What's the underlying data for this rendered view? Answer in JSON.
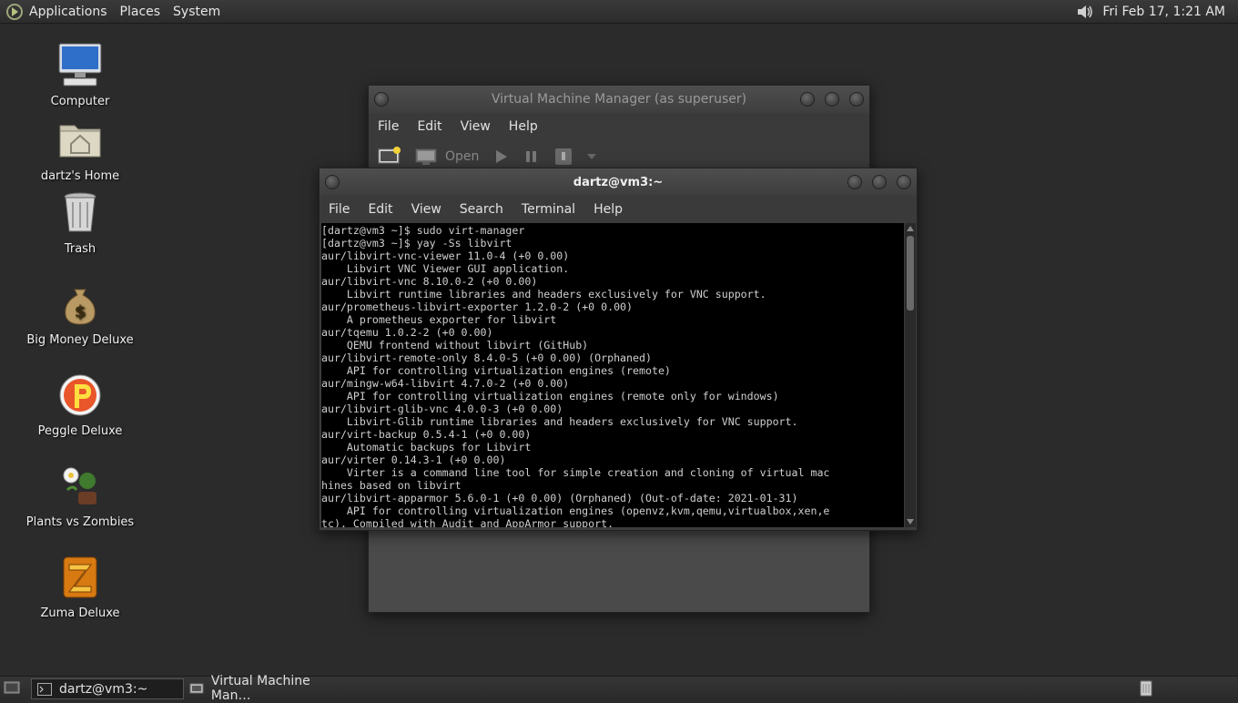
{
  "top_panel": {
    "menus": [
      "Applications",
      "Places",
      "System"
    ],
    "clock": "Fri Feb 17,  1:21 AM"
  },
  "desktop_icons": [
    {
      "label": "Computer",
      "icon": "computer-icon"
    },
    {
      "label": "dartz's Home",
      "icon": "home-folder-icon"
    },
    {
      "label": "Trash",
      "icon": "trash-icon"
    },
    {
      "label": "Big Money Deluxe",
      "icon": "money-bag-icon"
    },
    {
      "label": "Peggle Deluxe",
      "icon": "peggle-icon"
    },
    {
      "label": "Plants vs Zombies",
      "icon": "plants-vs-zombies-icon"
    },
    {
      "label": "Zuma Deluxe",
      "icon": "zuma-icon"
    }
  ],
  "vmm_window": {
    "title": "Virtual Machine Manager (as superuser)",
    "menus": [
      "File",
      "Edit",
      "View",
      "Help"
    ],
    "toolbar": {
      "open_label": "Open"
    }
  },
  "terminal_window": {
    "title": "dartz@vm3:~",
    "menus": [
      "File",
      "Edit",
      "View",
      "Search",
      "Terminal",
      "Help"
    ],
    "output": "[dartz@vm3 ~]$ sudo virt-manager\n[dartz@vm3 ~]$ yay -Ss libvirt\naur/libvirt-vnc-viewer 11.0-4 (+0 0.00)\n    Libvirt VNC Viewer GUI application.\naur/libvirt-vnc 8.10.0-2 (+0 0.00)\n    Libvirt runtime libraries and headers exclusively for VNC support.\naur/prometheus-libvirt-exporter 1.2.0-2 (+0 0.00)\n    A prometheus exporter for libvirt\naur/tqemu 1.0.2-2 (+0 0.00)\n    QEMU frontend without libvirt (GitHub)\naur/libvirt-remote-only 8.4.0-5 (+0 0.00) (Orphaned)\n    API for controlling virtualization engines (remote)\naur/mingw-w64-libvirt 4.7.0-2 (+0 0.00)\n    API for controlling virtualization engines (remote only for windows)\naur/libvirt-glib-vnc 4.0.0-3 (+0 0.00)\n    Libvirt-Glib runtime libraries and headers exclusively for VNC support.\naur/virt-backup 0.5.4-1 (+0 0.00)\n    Automatic backups for Libvirt\naur/virter 0.14.3-1 (+0 0.00)\n    Virter is a command line tool for simple creation and cloning of virtual mac\nhines based on libvirt\naur/libvirt-apparmor 5.6.0-1 (+0 0.00) (Orphaned) (Out-of-date: 2021-01-31)\n    API for controlling virtualization engines (openvz,kvm,qemu,virtualbox,xen,e\ntc). Compiled with Audit and AppArmor support."
  },
  "taskbar": {
    "tasks": [
      {
        "label": "dartz@vm3:~",
        "active": true
      },
      {
        "label": "Virtual Machine Man…",
        "active": false
      }
    ]
  }
}
